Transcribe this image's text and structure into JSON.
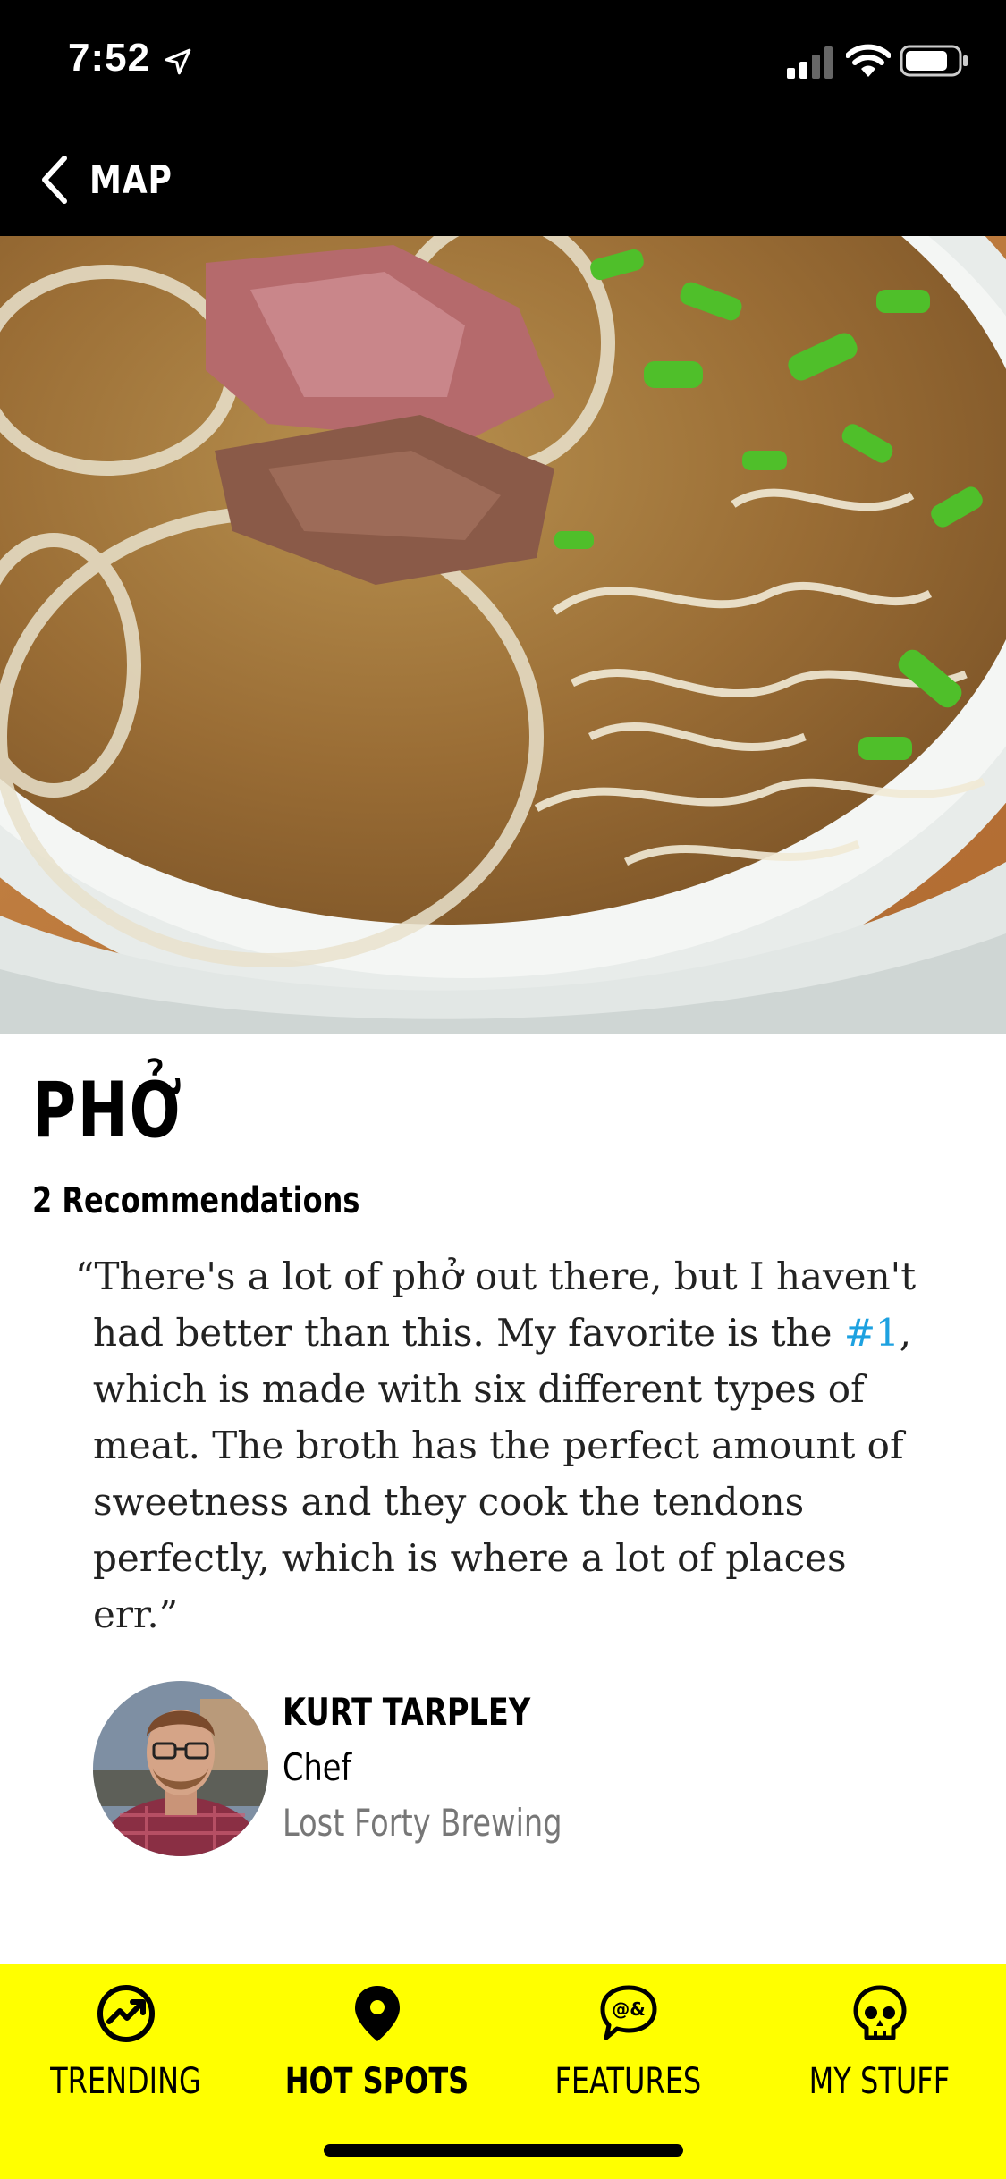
{
  "status_bar": {
    "time": "7:52"
  },
  "nav": {
    "back_label": "MAP"
  },
  "dish": {
    "title": "PHỞ",
    "recommendations": "2 Recommendations"
  },
  "quote": {
    "part1": "“There's a lot of phở out there, but I haven't had better than this. My favorite is the ",
    "link": "#1",
    "part2": ", which is made with six different types of meat. The broth has the perfect amount of sweetness and they cook the tendons perfectly, which is where a lot of places err.”"
  },
  "author": {
    "name": "KURT TARPLEY",
    "role": "Chef",
    "place": "Lost Forty Brewing"
  },
  "tabs": [
    {
      "label": "TRENDING",
      "icon": "trending-icon",
      "active": false
    },
    {
      "label": "HOT SPOTS",
      "icon": "map-pin-icon",
      "active": true
    },
    {
      "label": "FEATURES",
      "icon": "chat-bubble-icon",
      "active": false
    },
    {
      "label": "MY STUFF",
      "icon": "skull-icon",
      "active": false
    }
  ],
  "colors": {
    "tab_bar": "#ffff00",
    "link": "#1da1e0",
    "nav": "#000000"
  }
}
